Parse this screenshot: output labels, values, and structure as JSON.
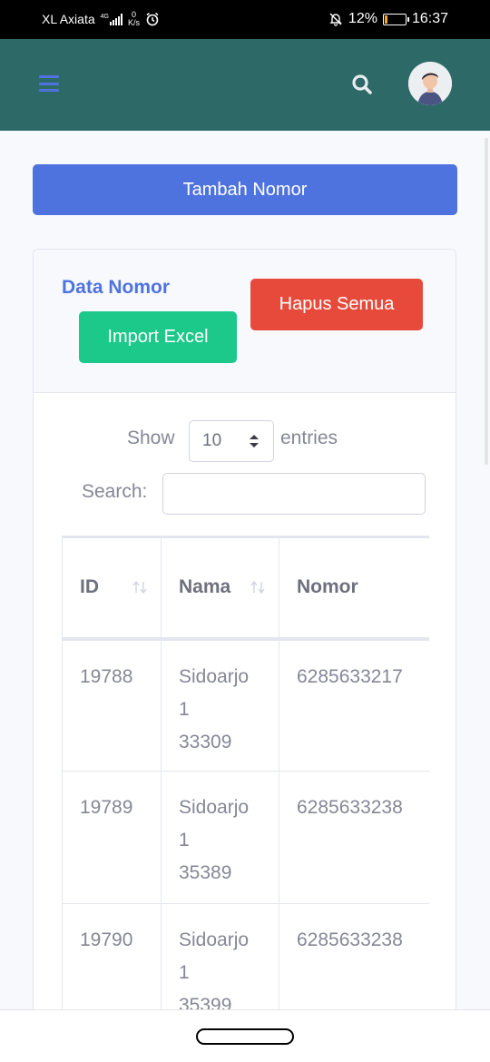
{
  "status_bar": {
    "carrier": "XL Axiata",
    "network_type": "4G",
    "net_speed_value": "0",
    "net_speed_unit": "K/s",
    "battery_percent": "12%",
    "battery_level": 0.12,
    "time": "16:37",
    "icons": [
      "signal-icon",
      "alarm-icon",
      "mute-bell-icon",
      "battery-icon"
    ]
  },
  "topbar": {
    "color": "#2d6a67",
    "icons": [
      "menu-icon",
      "search-icon",
      "avatar"
    ]
  },
  "add_button": {
    "label": "Tambah Nomor",
    "color": "#4e73df"
  },
  "card": {
    "title": "Data Nomor",
    "delete_all_label": "Hapus Semua",
    "delete_color": "#e74a3b",
    "import_label": "Import Excel",
    "import_color": "#1cc88a"
  },
  "datatable": {
    "show_label": "Show",
    "page_length": "10",
    "entries_label": "entries",
    "search_label": "Search:",
    "search_value": "",
    "columns": [
      "ID",
      "Nama",
      "Nomor"
    ],
    "rows": [
      {
        "id": "19788",
        "nama_line1": "Sidoarjo",
        "nama_line2": "1",
        "nama_line3": "33309",
        "nomor": "6285633217"
      },
      {
        "id": "19789",
        "nama_line1": "Sidoarjo",
        "nama_line2": "1",
        "nama_line3": "35389",
        "nomor": "6285633238"
      },
      {
        "id": "19790",
        "nama_line1": "Sidoarjo",
        "nama_line2": "1",
        "nama_line3": "35399",
        "nomor": "6285633238"
      }
    ]
  }
}
